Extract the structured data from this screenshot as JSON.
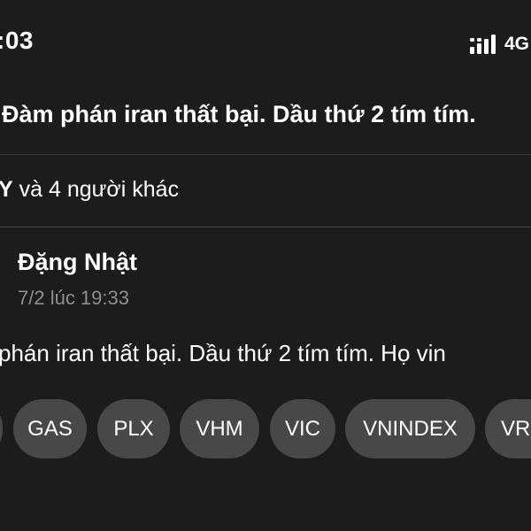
{
  "status_bar": {
    "time": ":03",
    "network": "4G",
    "signal_icon": "signal-bars-icon"
  },
  "post": {
    "title": "Đàm phán iran thất bại. Dầu thứ 2 tím tím.",
    "likes": {
      "name_fragment": "Y",
      "others_text": " và 4 người khác"
    },
    "author": "Đặng Nhật",
    "timestamp": "7/2 lúc 19:33",
    "body": "phán iran thất bại. Dầu thứ 2 tím tím. Họ vin"
  },
  "tags": [
    "",
    "GAS",
    "PLX",
    "VHM",
    "VIC",
    "VNINDEX",
    "VR"
  ],
  "colors": {
    "background": "#1c1c1e",
    "tag_background": "#48484a",
    "secondary_text": "#8e8e93",
    "divider": "#3a3a3c"
  }
}
